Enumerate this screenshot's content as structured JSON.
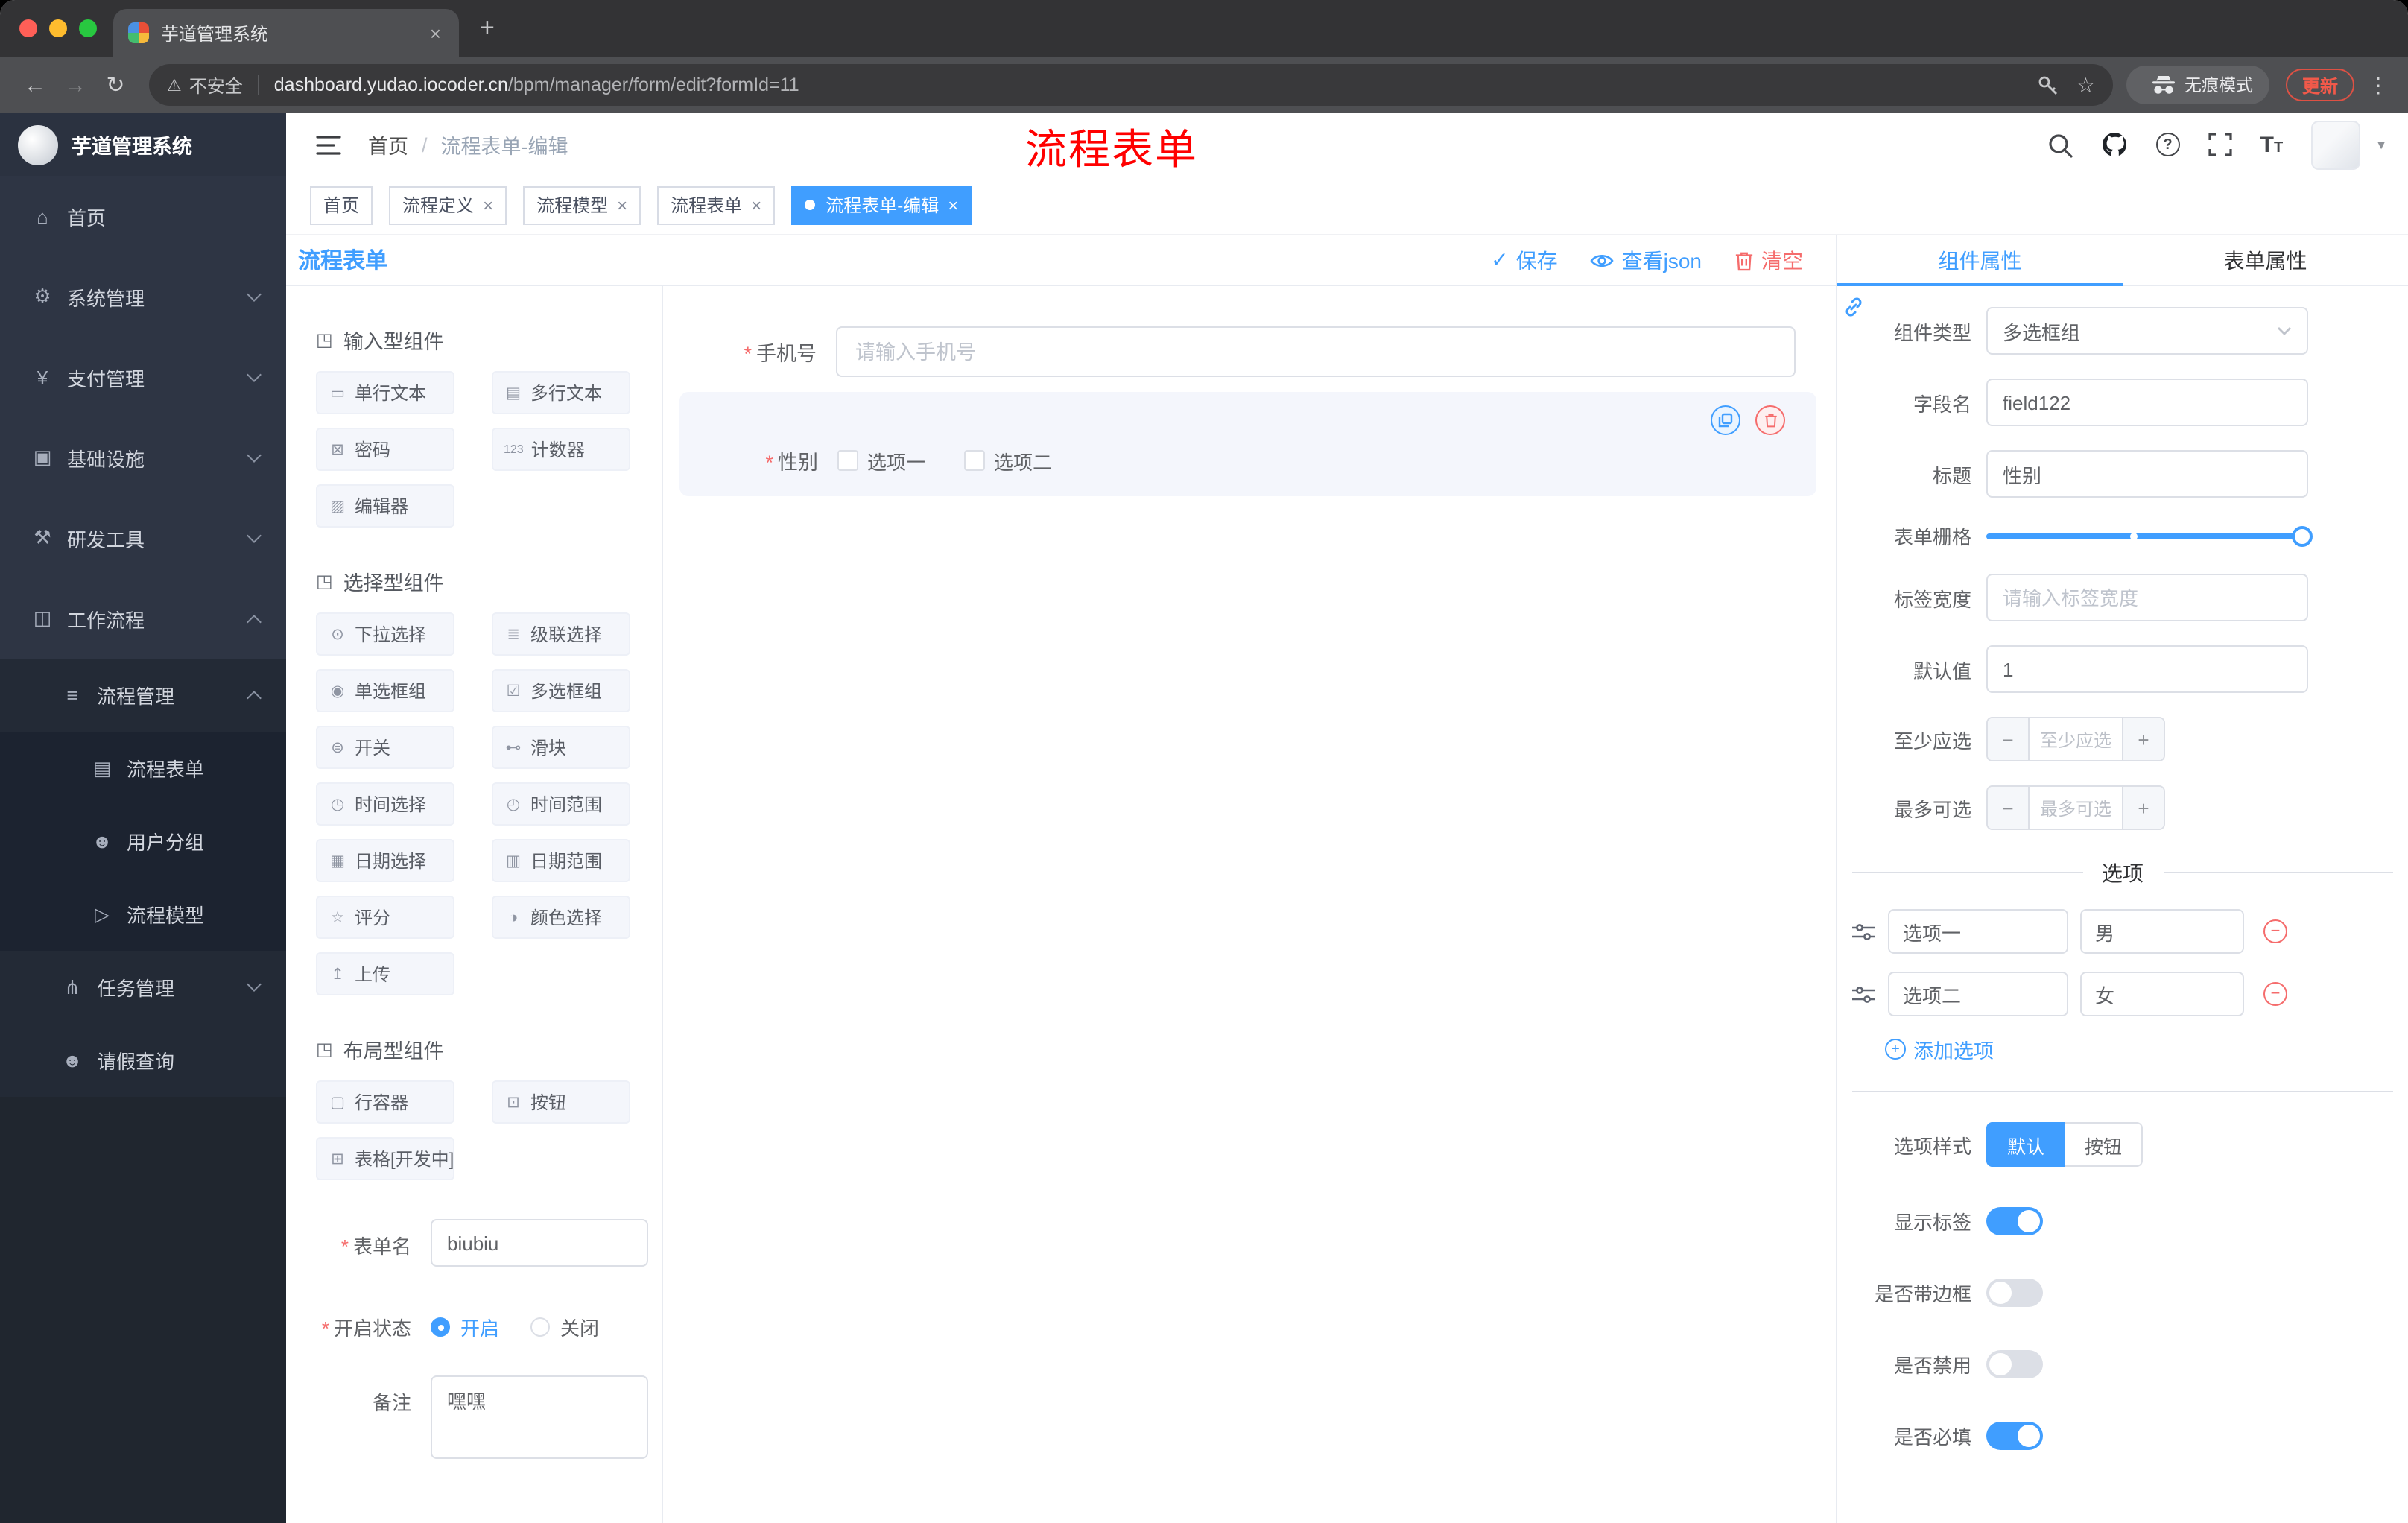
{
  "colors": {
    "accent": "#409eff",
    "danger": "#f56c6c",
    "annotation": "#ff0000",
    "tag_active_bg": "#409eff"
  },
  "icons": {
    "close": "×",
    "new_tab": "+",
    "back": "←",
    "forward": "→",
    "reload": "↻",
    "warning": "⚠",
    "star": "☆",
    "menu_dots": "⋮",
    "caret_down": "▼",
    "check": "✓",
    "minus": "−",
    "plus": "+",
    "question": "?",
    "font_big": "T",
    "font_small": "T",
    "required": "*"
  },
  "browser": {
    "tab_title": "芋道管理系统",
    "security_label": "不安全",
    "url_domain": "dashboard.yudao.iocoder.cn",
    "url_path": "/bpm/manager/form/edit?formId=11",
    "incognito_label": "无痕模式",
    "update_label": "更新"
  },
  "sidebar": {
    "logo_title": "芋道管理系统",
    "items": [
      {
        "icon": "⌂",
        "label": "首页"
      },
      {
        "icon": "⚙",
        "label": "系统管理"
      },
      {
        "icon": "¥",
        "label": "支付管理"
      },
      {
        "icon": "▣",
        "label": "基础设施"
      },
      {
        "icon": "⚒",
        "label": "研发工具"
      },
      {
        "icon": "◫",
        "label": "工作流程"
      },
      {
        "icon": "≡",
        "label": "流程管理"
      },
      {
        "icon": "▤",
        "label": "流程表单"
      },
      {
        "icon": "☻",
        "label": "用户分组"
      },
      {
        "icon": "▷",
        "label": "流程模型"
      },
      {
        "icon": "⋔",
        "label": "任务管理"
      },
      {
        "icon": "☻",
        "label": "请假查询"
      }
    ]
  },
  "header": {
    "breadcrumb_home": "首页",
    "breadcrumb_sep": "/",
    "breadcrumb_current": "流程表单-编辑",
    "annotation": "流程表单"
  },
  "tags": [
    {
      "label": "首页"
    },
    {
      "label": "流程定义"
    },
    {
      "label": "流程模型"
    },
    {
      "label": "流程表单"
    },
    {
      "label": "流程表单-编辑"
    }
  ],
  "designer": {
    "title": "流程表单",
    "save": "保存",
    "view_json": "查看json",
    "clear": "清空"
  },
  "components": {
    "sec_icon": "◳",
    "sec1_title": "输入型组件",
    "sec1": [
      {
        "icon": "▭",
        "label": "单行文本"
      },
      {
        "icon": "▤",
        "label": "多行文本"
      },
      {
        "icon": "⊠",
        "label": "密码"
      },
      {
        "icon": "123",
        "label": "计数器"
      },
      {
        "icon": "▨",
        "label": "编辑器"
      }
    ],
    "sec2_title": "选择型组件",
    "sec2": [
      {
        "icon": "⊙",
        "label": "下拉选择"
      },
      {
        "icon": "≣",
        "label": "级联选择"
      },
      {
        "icon": "◉",
        "label": "单选框组"
      },
      {
        "icon": "☑",
        "label": "多选框组"
      },
      {
        "icon": "⊜",
        "label": "开关"
      },
      {
        "icon": "⊷",
        "label": "滑块"
      },
      {
        "icon": "◷",
        "label": "时间选择"
      },
      {
        "icon": "◴",
        "label": "时间范围"
      },
      {
        "icon": "▦",
        "label": "日期选择"
      },
      {
        "icon": "▥",
        "label": "日期范围"
      },
      {
        "icon": "☆",
        "label": "评分"
      },
      {
        "icon": "◑",
        "label": "颜色选择"
      },
      {
        "icon": "↥",
        "label": "上传"
      }
    ],
    "sec3_title": "布局型组件",
    "sec3": [
      {
        "icon": "▢",
        "label": "行容器"
      },
      {
        "icon": "⊡",
        "label": "按钮"
      },
      {
        "icon": "⊞",
        "label": "表格[开发中]"
      }
    ],
    "form": {
      "name_label": "表单名",
      "name_value": "biubiu",
      "status_label": "开启状态",
      "status_on": "开启",
      "status_off": "关闭",
      "remark_label": "备注",
      "remark_value": "嘿嘿"
    }
  },
  "canvas": {
    "phone_label": "手机号",
    "phone_placeholder": "请输入手机号",
    "gender_label": "性别",
    "gender_opt1": "选项一",
    "gender_opt2": "选项二"
  },
  "props": {
    "tab_component": "组件属性",
    "tab_form": "表单属性",
    "type_label": "组件类型",
    "type_value": "多选框组",
    "field_label": "字段名",
    "field_value": "field122",
    "title_label": "标题",
    "title_value": "性别",
    "grid_label": "表单栅格",
    "width_label": "标签宽度",
    "width_placeholder": "请输入标签宽度",
    "default_label": "默认值",
    "default_value": "1",
    "min_label": "至少应选",
    "min_placeholder": "至少应选",
    "max_label": "最多可选",
    "max_placeholder": "最多可选",
    "options_divider": "选项",
    "opt1_label": "选项一",
    "opt1_value": "男",
    "opt2_label": "选项二",
    "opt2_value": "女",
    "add_option": "添加选项",
    "style_label": "选项样式",
    "style_default": "默认",
    "style_button": "按钮",
    "sw1_label": "显示标签",
    "sw2_label": "是否带边框",
    "sw3_label": "是否禁用",
    "sw4_label": "是否必填"
  }
}
